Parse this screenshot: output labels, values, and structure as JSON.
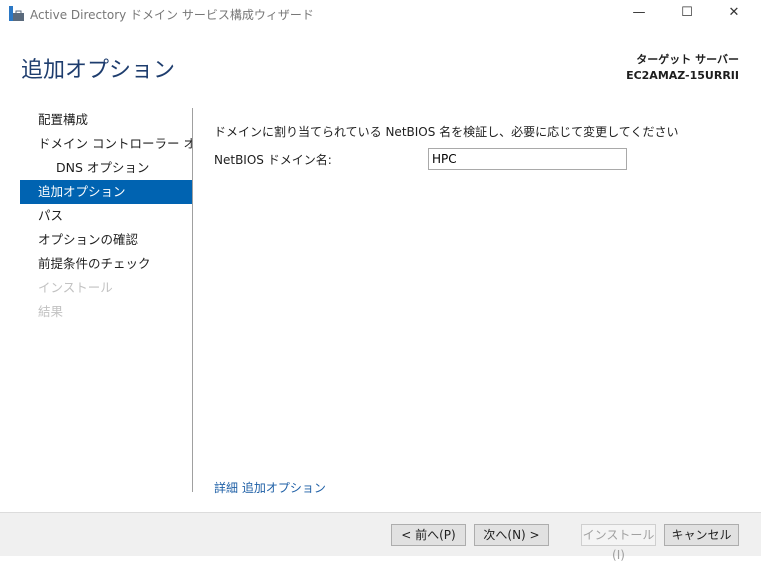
{
  "window": {
    "title": "Active Directory ドメイン サービス構成ウィザード",
    "minimize": "—",
    "maximize": "☐",
    "close": "✕"
  },
  "header": {
    "title": "追加オプション",
    "target_label": "ターゲット サーバー",
    "target_server": "EC2AMAZ-15URRII"
  },
  "sidebar": {
    "items": [
      {
        "label": "配置構成"
      },
      {
        "label": "ドメイン コントローラー オプシ..."
      },
      {
        "label": "DNS オプション"
      },
      {
        "label": "追加オプション"
      },
      {
        "label": "パス"
      },
      {
        "label": "オプションの確認"
      },
      {
        "label": "前提条件のチェック"
      },
      {
        "label": "インストール"
      },
      {
        "label": "結果"
      }
    ]
  },
  "main": {
    "description": "ドメインに割り当てられている NetBIOS 名を検証し、必要に応じて変更してください",
    "netbios_label": "NetBIOS ドメイン名:",
    "netbios_value": "HPC",
    "more_link": "詳細 追加オプション"
  },
  "buttons": {
    "prev": "< 前へ(P)",
    "next": "次へ(N) >",
    "install": "インストール(I)",
    "cancel": "キャンセル"
  }
}
